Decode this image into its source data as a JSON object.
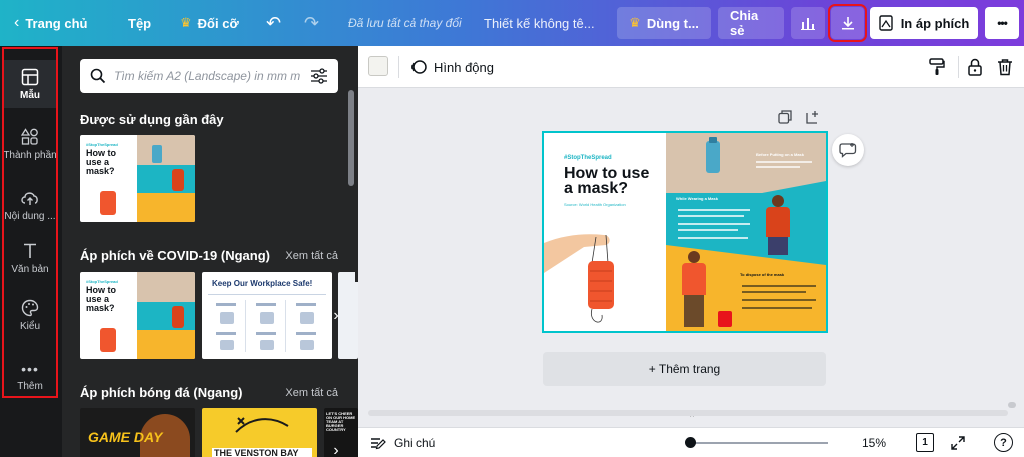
{
  "topbar": {
    "home_label": "Trang chủ",
    "file_label": "Tệp",
    "resize_label": "Đối cỡ",
    "saved_status": "Đã lưu tất cả thay đổi",
    "design_title": "Thiết kế không tê...",
    "try_label": "Dùng t...",
    "share_label": "Chia sẻ",
    "print_label": "In áp phích",
    "more_label": "•••"
  },
  "rail": {
    "items": [
      {
        "label": "Mẫu",
        "icon": "layout-icon"
      },
      {
        "label": "Thành phần",
        "icon": "shapes-icon"
      },
      {
        "label": "Nội dung ...",
        "icon": "cloud-upload-icon"
      },
      {
        "label": "Văn bản",
        "icon": "text-icon"
      },
      {
        "label": "Kiểu",
        "icon": "palette-icon"
      },
      {
        "label": "Thêm",
        "icon": "more-icon"
      }
    ]
  },
  "panel": {
    "search_placeholder": "Tìm kiếm A2 (Landscape) in mm m",
    "recent_title": "Được sử dụng gần đây",
    "covid_title": "Áp phích về COVID-19 (Ngang)",
    "covid_see_all": "Xem tất cả",
    "football_title": "Áp phích bóng đá (Ngang)",
    "football_see_all": "Xem tất cả"
  },
  "thumbs": {
    "mask_hashtag": "#StopTheSpread",
    "mask_title": "How to use a mask?",
    "workplace_title": "Keep Our Workplace Safe!",
    "game_day": "GAME DAY",
    "venston": "THE VENSTON BAY",
    "lets_cheer": "LET'S CHEER ON OUR HOME TEAM AT BURGER COUNTRY"
  },
  "editor": {
    "animate_label": "Hình động",
    "add_page_label": "+ Thêm trang"
  },
  "design": {
    "hashtag": "#StopTheSpread",
    "title": "How to use a mask?",
    "source": "Source: World Health Organization",
    "before_label": "Before Putting on a Mask",
    "wearing_label": "While Wearing a Mask",
    "dispose_label": "To dispose of the mask"
  },
  "bottombar": {
    "notes_label": "Ghi chú",
    "zoom_label": "15%",
    "page_count": "1",
    "help_label": "?"
  },
  "colors": {
    "highlight": "#e8141b",
    "selection": "#00c4cc",
    "teal": "#1cb5c4",
    "yellow": "#f7b52c",
    "beige": "#d8c3ad",
    "orange": "#f0562e"
  }
}
